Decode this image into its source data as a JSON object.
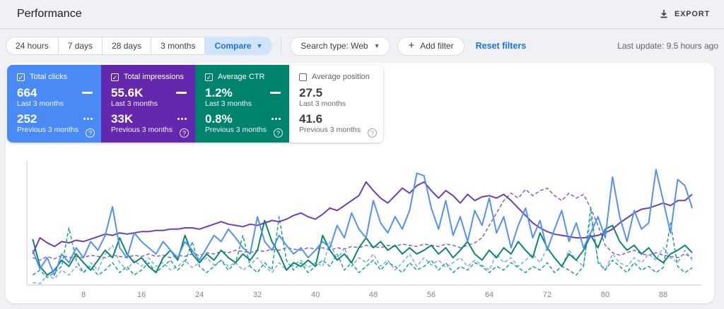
{
  "colors": {
    "page_bg": "#eff1f4",
    "accent_blue": "#1a73e8",
    "compare_bg": "#d2e3fc",
    "border": "#dadce0",
    "text": "#3c4043",
    "muted": "#5f6368",
    "axis": "#dadce0"
  },
  "header": {
    "title": "Performance",
    "export_label": "EXPORT"
  },
  "toolbar": {
    "date_buttons": {
      "b24h": "24 hours",
      "b7d": "7 days",
      "b28d": "28 days",
      "b3m": "3 months"
    },
    "compare_label": "Compare",
    "search_type_label": "Search type: Web",
    "add_filter_label": "Add filter",
    "reset_filters_label": "Reset filters",
    "last_update": "Last update: 9.5 hours ago"
  },
  "cards": [
    {
      "label": "Total clicks",
      "checked": true,
      "bg": "#4a8af4",
      "value1": "664",
      "caption1": "Last 3 months",
      "value2": "252",
      "caption2": "Previous 3 months",
      "help": "?"
    },
    {
      "label": "Total impressions",
      "checked": true,
      "bg": "#6328ae",
      "value1": "55.6K",
      "caption1": "Last 3 months",
      "value2": "33K",
      "caption2": "Previous 3 months",
      "help": "?"
    },
    {
      "label": "Average CTR",
      "checked": true,
      "bg": "#00836d",
      "value1": "1.2%",
      "caption1": "Last 3 months",
      "value2": "0.8%",
      "caption2": "Previous 3 months",
      "help": "?"
    },
    {
      "label": "Average position",
      "checked": false,
      "bg": "#ffffff",
      "value1": "27.5",
      "caption1": "Last 3 months",
      "value2": "41.6",
      "caption2": "Previous 3 months",
      "help": "?"
    }
  ],
  "chart_data": {
    "type": "line",
    "title": "",
    "xlabel": "",
    "ylabel": "",
    "x_range": [
      1,
      92
    ],
    "x_ticks": [
      8,
      16,
      24,
      32,
      40,
      48,
      56,
      64,
      72,
      80,
      88
    ],
    "ylim": [
      0,
      100
    ],
    "grid": false,
    "legend_position": "none (metric cards act as legend)",
    "series": [
      {
        "id": "impressions-previous",
        "name": "Total impressions — Previous 3 months",
        "color": "#8a5cc9",
        "dashed": true,
        "values": [
          22,
          20,
          23,
          21,
          24,
          22,
          23,
          22,
          24,
          23,
          22,
          24,
          23,
          22,
          24,
          23,
          25,
          23,
          24,
          22,
          24,
          23,
          25,
          24,
          26,
          25,
          27,
          26,
          28,
          27,
          26,
          28,
          27,
          29,
          28,
          30,
          29,
          28,
          30,
          29,
          30,
          28,
          30,
          29,
          31,
          30,
          32,
          31,
          30,
          32,
          31,
          33,
          32,
          31,
          33,
          32,
          31,
          33,
          32,
          30,
          32,
          34,
          38,
          48,
          58,
          68,
          74,
          70,
          77,
          72,
          76,
          78,
          72,
          68,
          74,
          70,
          73,
          62,
          48,
          32,
          26,
          24,
          26,
          28,
          25,
          24,
          26,
          24,
          23,
          22,
          25,
          22
        ]
      },
      {
        "id": "clicks-previous",
        "name": "Total clicks — Previous 3 months",
        "color": "#7baaf7",
        "dashed": true,
        "values": [
          2,
          1,
          8,
          5,
          12,
          8,
          15,
          10,
          18,
          12,
          25,
          32,
          18,
          12,
          20,
          15,
          22,
          15,
          18,
          12,
          15,
          20,
          14,
          18,
          22,
          16,
          20,
          15,
          18,
          12,
          16,
          22,
          15,
          10,
          18,
          12,
          16,
          20,
          14,
          18,
          15,
          35,
          20,
          30,
          15,
          22,
          18,
          25,
          15,
          20,
          12,
          18,
          25,
          15,
          22,
          16,
          20,
          14,
          18,
          22,
          15,
          20,
          16,
          12,
          25,
          18,
          22,
          15,
          20,
          25,
          18,
          30,
          22,
          15,
          28,
          20,
          15,
          55,
          20,
          12,
          25,
          18,
          15,
          22,
          18,
          25,
          20,
          30,
          22,
          18,
          28,
          20
        ]
      },
      {
        "id": "ctr-previous",
        "name": "Average CTR — Previous 3 months",
        "color": "#17a58a",
        "dashed": true,
        "values": [
          8,
          12,
          6,
          10,
          15,
          46,
          20,
          10,
          15,
          8,
          12,
          18,
          10,
          15,
          8,
          12,
          18,
          10,
          15,
          20,
          12,
          18,
          35,
          15,
          10,
          15,
          20,
          12,
          18,
          40,
          15,
          10,
          18,
          12,
          55,
          20,
          12,
          18,
          10,
          15,
          20,
          15,
          25,
          12,
          18,
          10,
          15,
          20,
          12,
          18,
          15,
          10,
          18,
          12,
          15,
          20,
          12,
          18,
          10,
          15,
          12,
          18,
          15,
          10,
          15,
          12,
          18,
          14,
          10,
          15,
          12,
          18,
          10,
          15,
          12,
          8,
          15,
          62,
          18,
          12,
          20,
          15,
          10,
          18,
          12,
          15,
          10,
          14,
          50,
          15,
          10,
          14
        ]
      },
      {
        "id": "ctr-current",
        "name": "Average CTR — Last 3 months",
        "color": "#0c8768",
        "dashed": false,
        "values": [
          37,
          15,
          8,
          12,
          20,
          15,
          25,
          18,
          12,
          20,
          28,
          22,
          38,
          25,
          18,
          22,
          15,
          10,
          22,
          28,
          20,
          40,
          25,
          18,
          25,
          20,
          28,
          22,
          18,
          25,
          20,
          28,
          52,
          35,
          25,
          12,
          18,
          15,
          20,
          15,
          40,
          28,
          20,
          25,
          18,
          30,
          38,
          30,
          35,
          28,
          32,
          25,
          30,
          25,
          28,
          32,
          25,
          30,
          22,
          28,
          35,
          25,
          20,
          28,
          22,
          30,
          25,
          35,
          28,
          22,
          42,
          30,
          22,
          15,
          25,
          20,
          28,
          40,
          30,
          45,
          48,
          35,
          28,
          32,
          25,
          30,
          22,
          18,
          25,
          28,
          32,
          26
        ]
      },
      {
        "id": "impressions-current",
        "name": "Total impressions — Last 3 months",
        "color": "#6b3fb8",
        "dashed": false,
        "values": [
          25,
          38,
          34,
          31,
          35,
          34,
          36,
          35,
          37,
          39,
          41,
          40,
          42,
          41,
          42,
          43,
          43,
          44,
          44,
          45,
          45,
          46,
          46,
          45,
          47,
          49,
          51,
          49,
          48,
          47,
          49,
          48,
          50,
          52,
          51,
          53,
          56,
          58,
          55,
          53,
          57,
          62,
          60,
          64,
          68,
          72,
          83,
          76,
          70,
          66,
          72,
          78,
          74,
          80,
          83,
          76,
          70,
          76,
          72,
          66,
          73,
          68,
          71,
          72,
          70,
          73,
          68,
          62,
          56,
          50,
          46,
          43,
          41,
          40,
          39,
          38,
          38,
          39,
          40,
          42,
          45,
          50,
          54,
          58,
          61,
          62,
          64,
          66,
          64,
          68,
          68,
          73
        ]
      },
      {
        "id": "clicks-current",
        "name": "Total clicks — Last 3 months",
        "color": "#5491f5",
        "dashed": false,
        "values": [
          28,
          13,
          22,
          8,
          25,
          18,
          30,
          22,
          35,
          28,
          40,
          63,
          30,
          22,
          42,
          35,
          30,
          25,
          35,
          28,
          22,
          35,
          28,
          20,
          30,
          40,
          35,
          45,
          38,
          30,
          25,
          55,
          35,
          28,
          40,
          32,
          25,
          30,
          22,
          28,
          35,
          30,
          48,
          38,
          58,
          45,
          38,
          68,
          50,
          42,
          55,
          45,
          60,
          90,
          88,
          62,
          45,
          68,
          40,
          55,
          35,
          60,
          48,
          70,
          42,
          55,
          30,
          48,
          62,
          38,
          52,
          28,
          45,
          60,
          35,
          50,
          30,
          42,
          55,
          38,
          87,
          55,
          35,
          60,
          45,
          50,
          93,
          68,
          42,
          85,
          80,
          62
        ]
      }
    ]
  }
}
